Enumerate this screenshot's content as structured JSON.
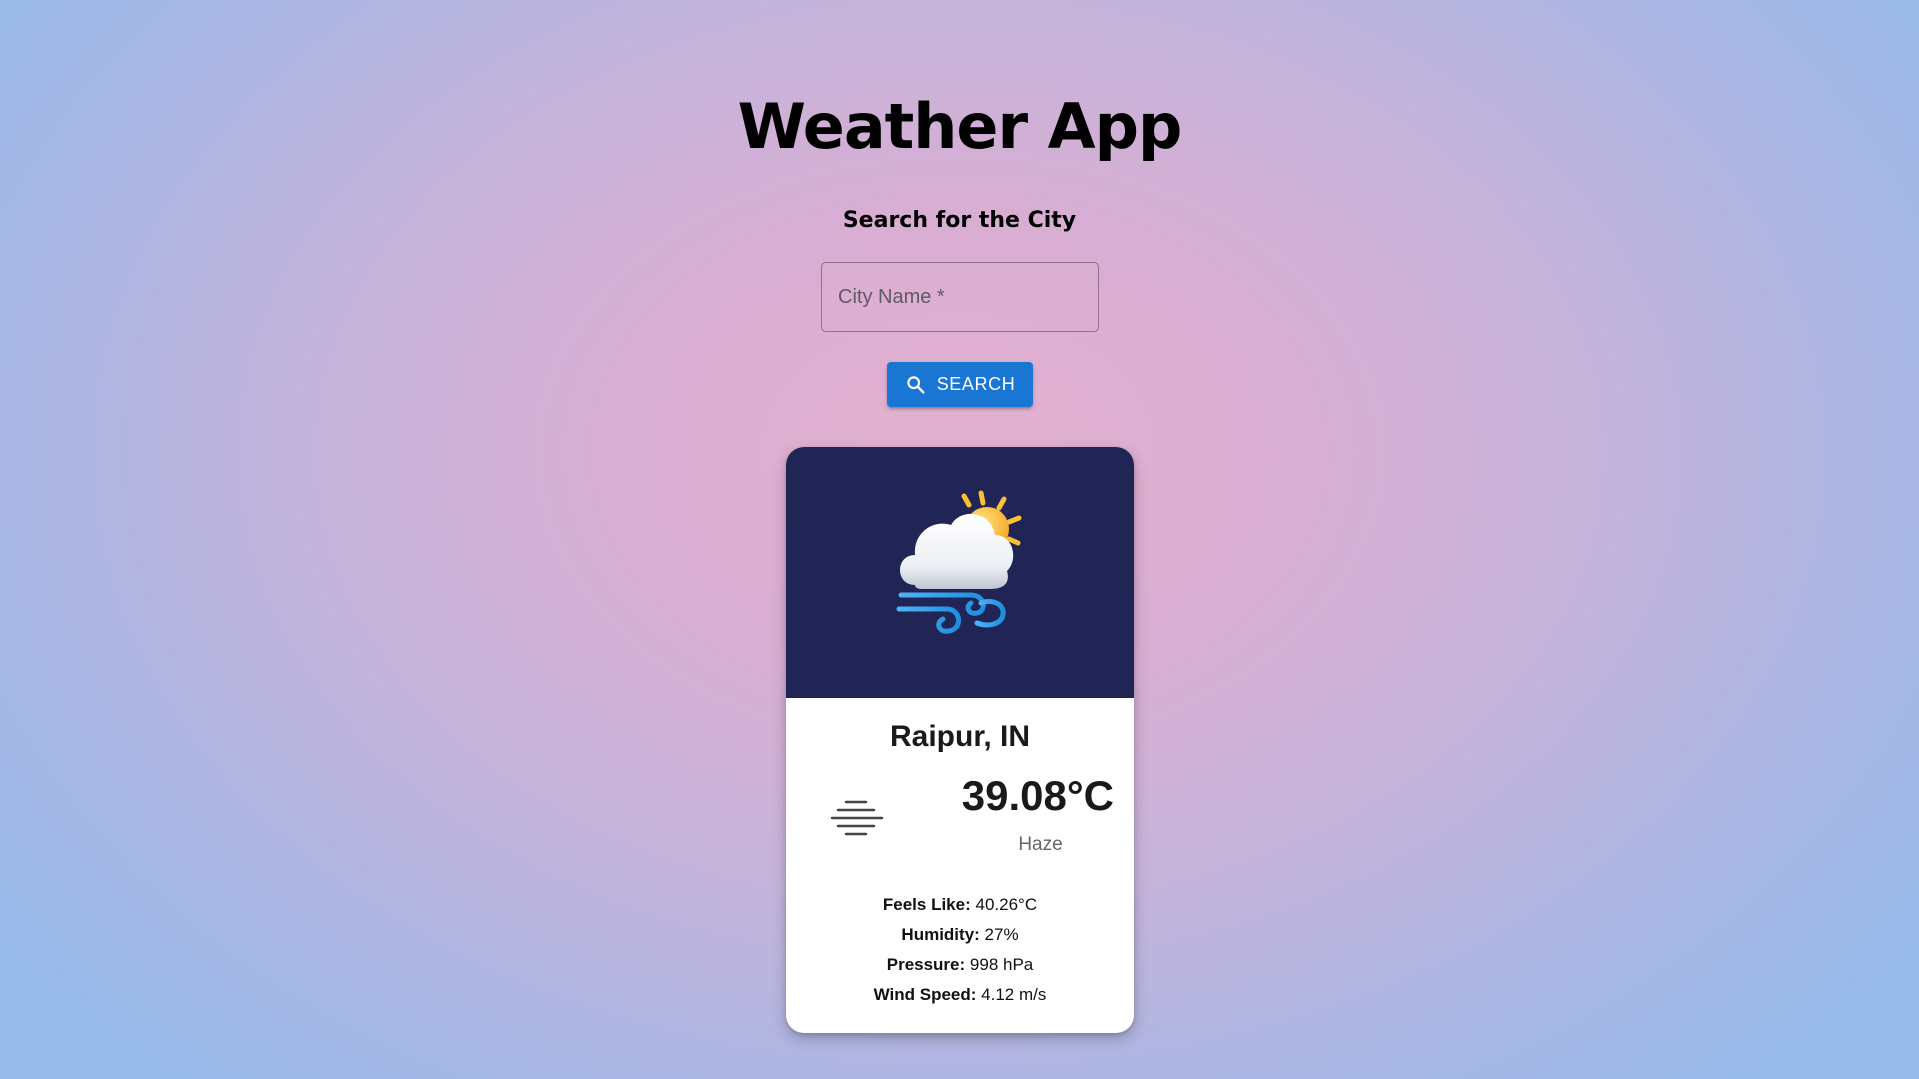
{
  "app": {
    "title": "Weather App",
    "subtitle": "Search for the City"
  },
  "search": {
    "placeholder": "City Name *",
    "value": "",
    "button_label": "SEARCH",
    "button_icon": "search-icon",
    "button_color": "#1976d2"
  },
  "weather": {
    "image_icon": "cloud-sun-wind-icon",
    "location": "Raipur, IN",
    "condition_icon": "haze-icon",
    "temperature": "39.08°C",
    "condition": "Haze",
    "details": [
      {
        "label": "Feels Like:",
        "value": "40.26°C"
      },
      {
        "label": "Humidity:",
        "value": "27%"
      },
      {
        "label": "Pressure:",
        "value": "998 hPa"
      },
      {
        "label": "Wind Speed:",
        "value": "4.12 m/s"
      }
    ]
  },
  "colors": {
    "card_header": "#212555",
    "accent": "#1976d2"
  }
}
